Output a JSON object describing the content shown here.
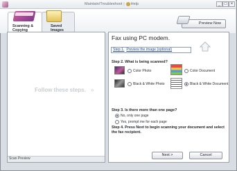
{
  "titlebar": {
    "links": [
      "Maintain/Troubleshoot",
      "Help"
    ],
    "window_controls": [
      "minimize-icon",
      "maximize-icon",
      "close-icon"
    ]
  },
  "tabs": [
    {
      "label": "Scanning &\nCopying",
      "icon": "scanner-icon",
      "active": true
    },
    {
      "label": "Saved\nImages",
      "icon": "folder-icon",
      "active": false
    }
  ],
  "toolbar": {
    "preview_now_label": "Preview Now",
    "preview_icon": "scanner-preview-icon"
  },
  "left_panel": {
    "hint": "Follow these steps.",
    "hint_icon": "double-arrow-icon",
    "footer_label": "Scan Preview"
  },
  "right_panel": {
    "title": "Fax using PC modem.",
    "step1_prefix": "Step 1.",
    "step1_link": "Preview the image (optional)",
    "step2_heading": "Step 2.  What is being scanned?",
    "scan_types": [
      {
        "label": "Color Photo",
        "selected": false
      },
      {
        "label": "Black & White Photo",
        "selected": false
      },
      {
        "label": "Color Document",
        "selected": false
      },
      {
        "label": "Black & White Document",
        "selected": true
      }
    ],
    "step3_heading": "Step 3.  Is there more than one page?",
    "page_options": [
      {
        "label": "No, only one page",
        "selected": true
      },
      {
        "label": "Yes, prompt me for each page",
        "selected": false
      }
    ],
    "step4_text": "Step 4.  Press Next to begin scanning your document and select the fax recipient.",
    "next_label": "Next >",
    "cancel_label": "Cancel"
  }
}
